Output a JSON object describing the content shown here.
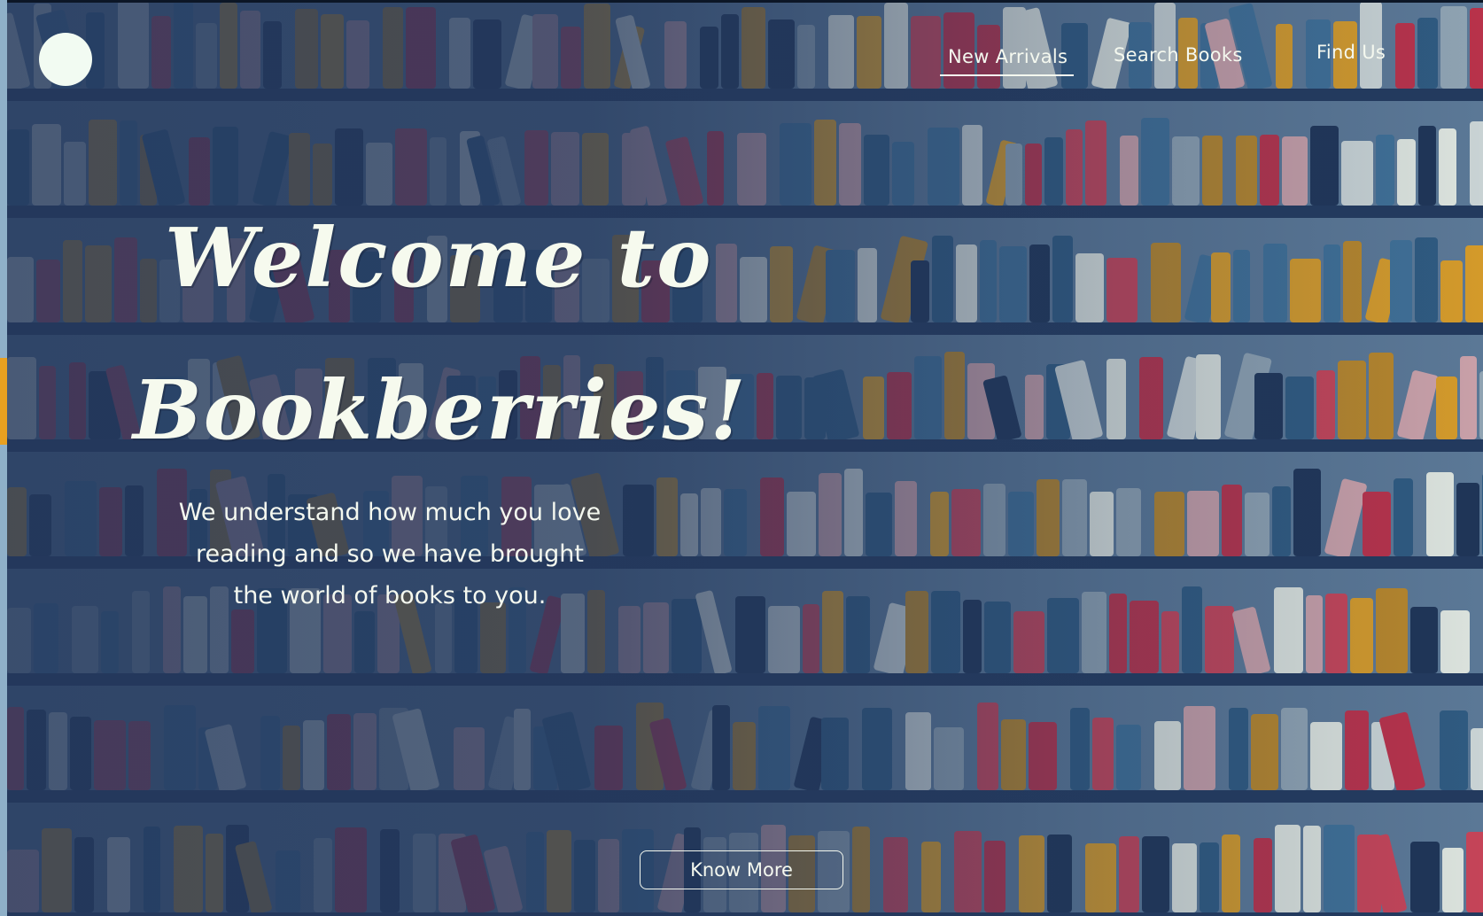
{
  "colors": {
    "background": "#23375a",
    "text": "#f4f8ef",
    "shelf": "#233a5e",
    "accent": "#e8a020",
    "logo": "#f2fbf2"
  },
  "logo": {
    "icon": "circle-logo-icon"
  },
  "nav": {
    "items": [
      {
        "label": "New Arrivals",
        "active": true
      },
      {
        "label": "Search Books",
        "active": false
      },
      {
        "label": "Find Us",
        "active": false
      }
    ]
  },
  "hero": {
    "title_line1": "Welcome to",
    "title_line2": "Bookberries!",
    "description": "We understand how much you love reading and so we have brought the world of books to you.",
    "cta_label": "Know More"
  },
  "background": {
    "description_icon": "bookshelf-illustration",
    "book_palette": [
      "#1f3557",
      "#2f5a80",
      "#3f6f96",
      "#8fa3b2",
      "#c9d3d4",
      "#dce3dd",
      "#b8324a",
      "#c54458",
      "#c9a0a8",
      "#d49a2a",
      "#b7862b"
    ]
  }
}
